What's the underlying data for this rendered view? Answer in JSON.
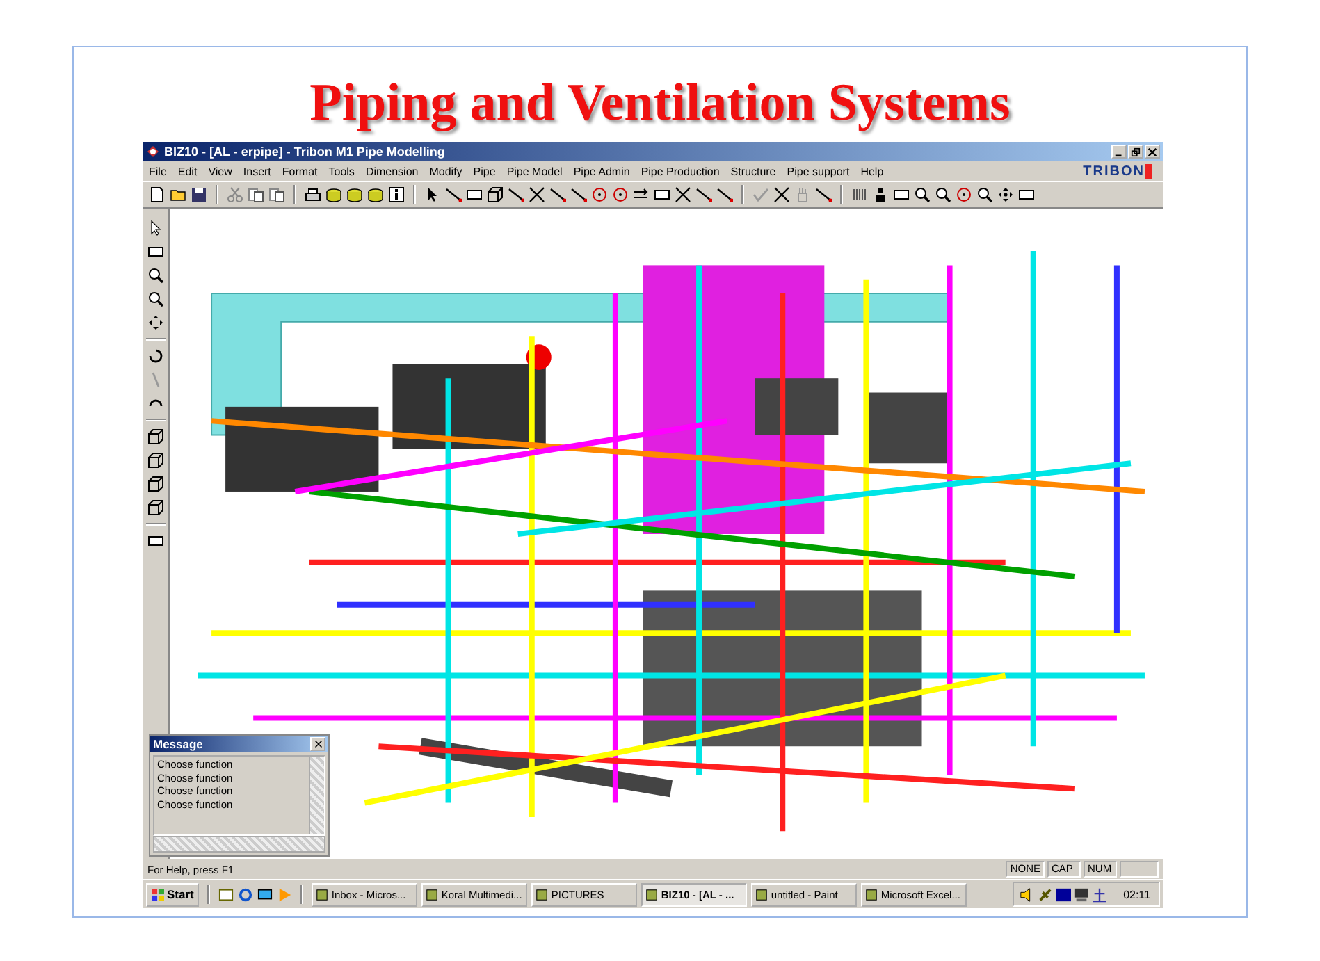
{
  "slide_title": "Piping and Ventilation Systems",
  "window": {
    "title": "BIZ10 - [AL - erpipe] - Tribon M1 Pipe Modelling",
    "logo": "TRIBON"
  },
  "menu": [
    "File",
    "Edit",
    "View",
    "Insert",
    "Format",
    "Tools",
    "Dimension",
    "Modify",
    "Pipe",
    "Pipe Model",
    "Pipe Admin",
    "Pipe Production",
    "Structure",
    "Pipe support",
    "Help"
  ],
  "message_panel": {
    "title": "Message",
    "lines": [
      "Choose function",
      "Choose function",
      "Choose function",
      "Choose function"
    ]
  },
  "status_bar": {
    "help_text": "For Help, press F1",
    "indicators": [
      "NONE",
      "CAP",
      "NUM"
    ]
  },
  "taskbar": {
    "start": "Start",
    "tasks": [
      {
        "label": "Inbox - Micros...",
        "selected": false
      },
      {
        "label": "Koral Multimedi...",
        "selected": false
      },
      {
        "label": "PICTURES",
        "selected": false
      },
      {
        "label": "BIZ10 - [AL - ...",
        "selected": true
      },
      {
        "label": "untitled - Paint",
        "selected": false
      },
      {
        "label": "Microsoft Excel...",
        "selected": false
      }
    ],
    "clock": "02:11"
  }
}
